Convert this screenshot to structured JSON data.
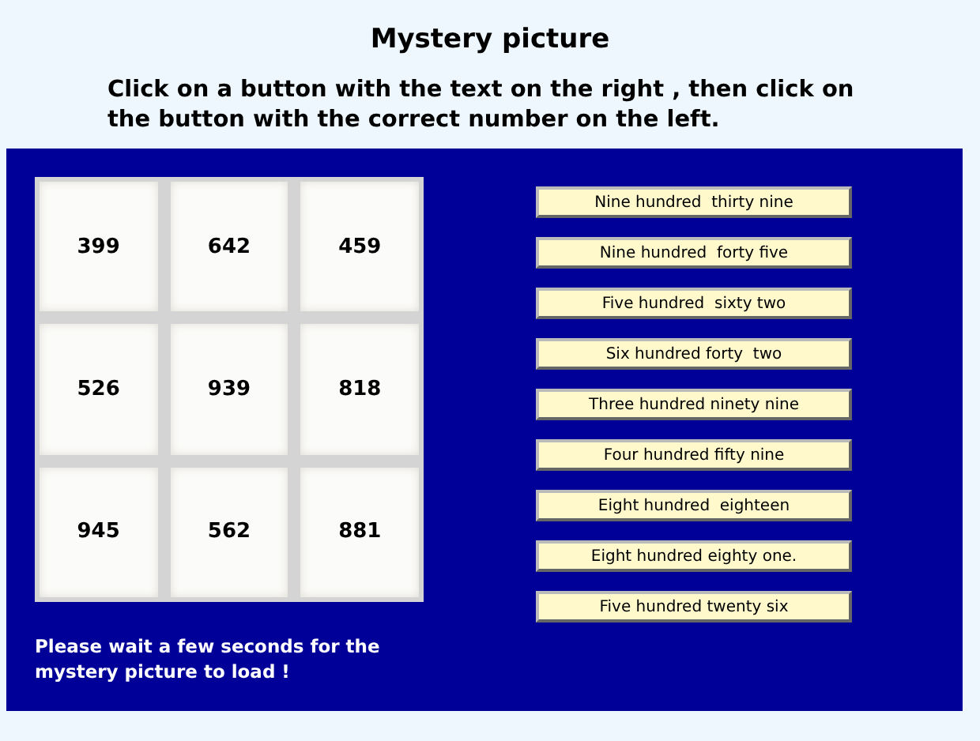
{
  "title": "Mystery picture",
  "instructions": "Click on a button with the text on the right , then click on the button with the correct number on the left.",
  "tiles": [
    "399",
    "642",
    "459",
    "526",
    "939",
    "818",
    "945",
    "562",
    "881"
  ],
  "word_buttons": [
    "Nine hundred  thirty nine",
    "Nine hundred  forty five",
    "Five hundred  sixty two",
    "Six hundred forty  two",
    "Three hundred ninety nine",
    "Four hundred fifty nine",
    "Eight hundred  eighteen",
    "Eight hundred eighty one.",
    "Five hundred twenty six"
  ],
  "notice": "Please wait a few seconds for the mystery picture to load !"
}
